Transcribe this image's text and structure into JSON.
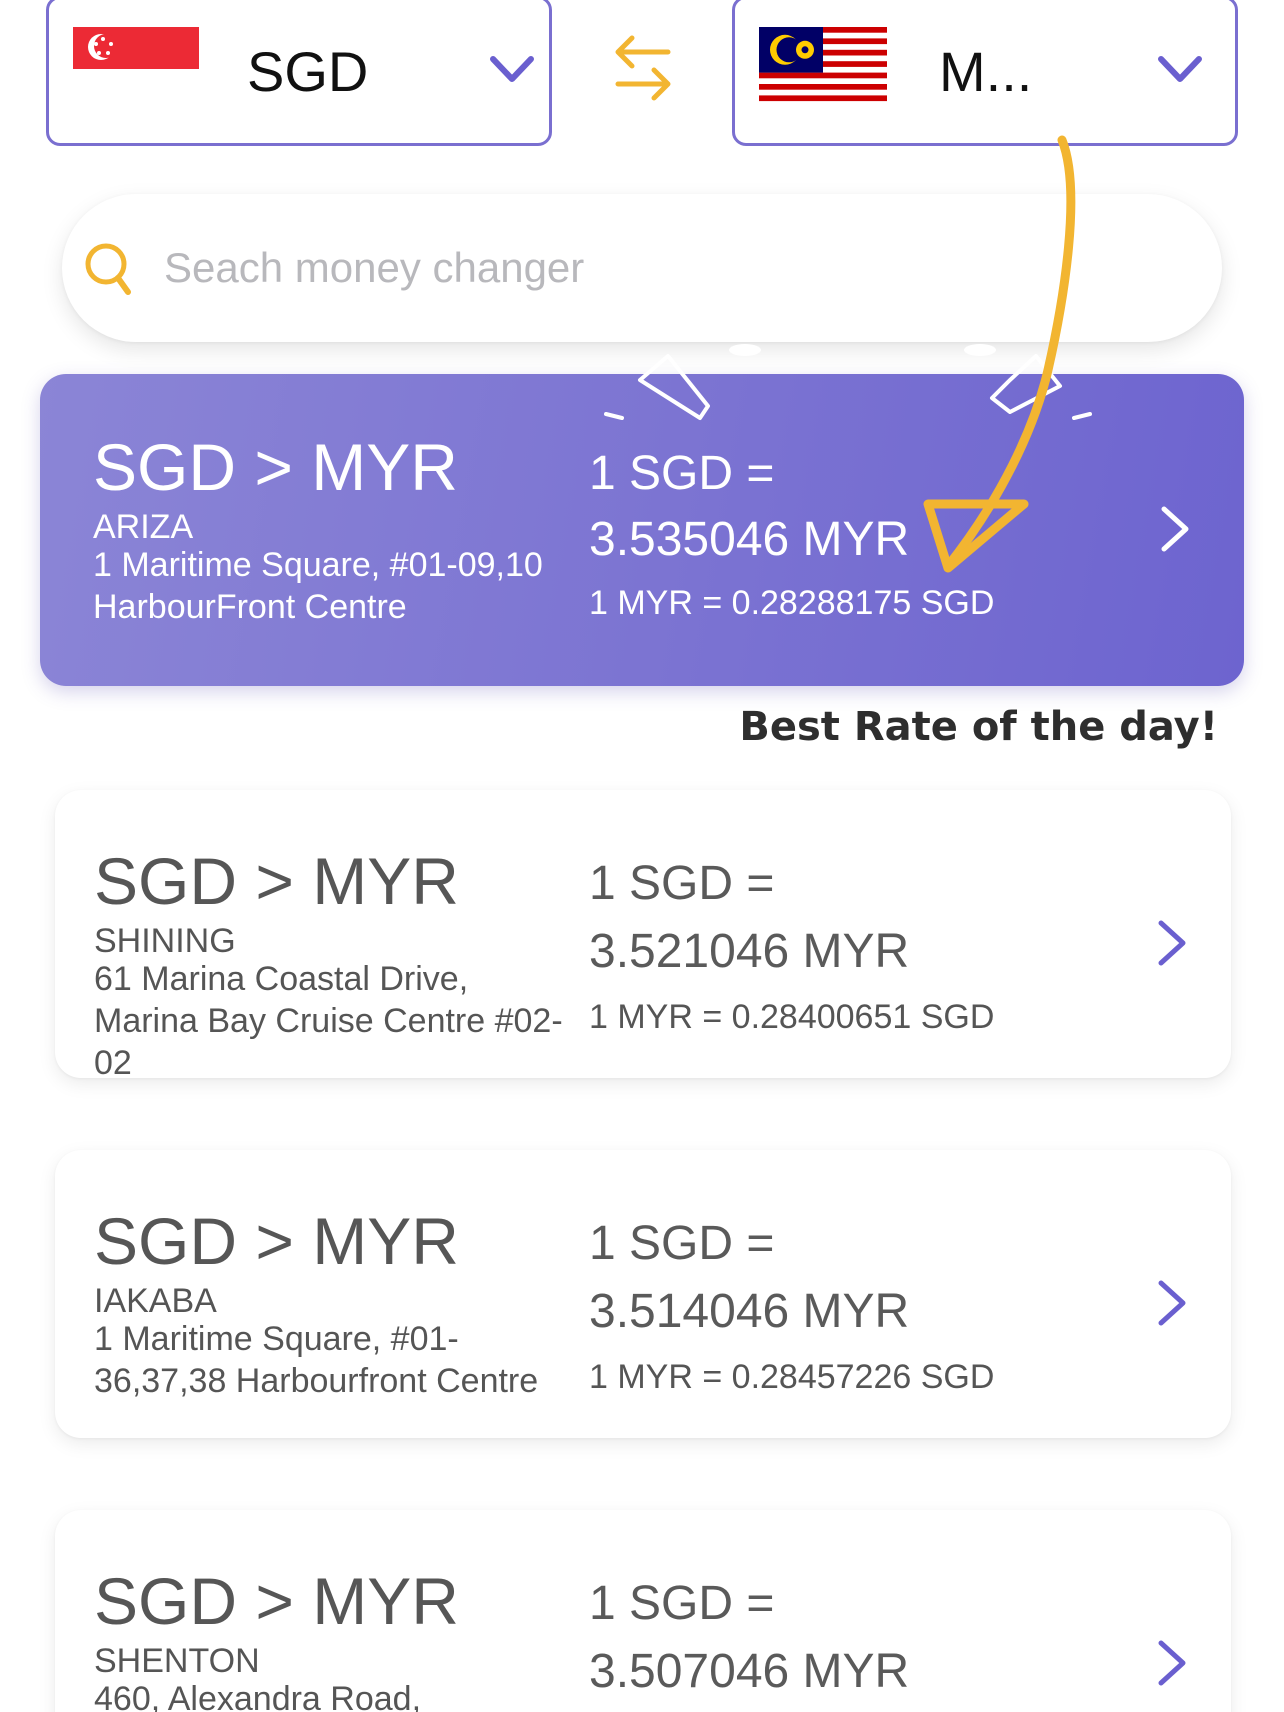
{
  "currency_from": {
    "code": "SGD",
    "flag": "singapore-flag"
  },
  "currency_to": {
    "code": "M...",
    "flag": "malaysia-flag"
  },
  "search": {
    "placeholder": "Seach money changer"
  },
  "colors": {
    "accent": "#7a6fd0",
    "highlight": "#f2b531",
    "best_card": "#7b73d2"
  },
  "best_label": "Best Rate of the day!",
  "offers": [
    {
      "pair": "SGD > MYR",
      "name": "ARIZA",
      "address": "1 Maritime Square, #01-09,10 HarbourFront Centre",
      "rate_line1": "1 SGD =",
      "rate_line2": "3.535046 MYR",
      "inverse": "1 MYR = 0.28288175 SGD"
    },
    {
      "pair": "SGD > MYR",
      "name": "SHINING",
      "address": "61 Marina Coastal Drive, Marina Bay Cruise Centre #02-02",
      "rate_line1": "1 SGD =",
      "rate_line2": "3.521046 MYR",
      "inverse": "1 MYR = 0.28400651 SGD"
    },
    {
      "pair": "SGD > MYR",
      "name": "IAKABA",
      "address": "1 Maritime Square, #01-36,37,38 Harbourfront Centre",
      "rate_line1": "1 SGD =",
      "rate_line2": "3.514046 MYR",
      "inverse": "1 MYR = 0.28457226 SGD"
    },
    {
      "pair": "SGD > MYR",
      "name": "SHENTON",
      "address": "460, Alexandra Road,",
      "rate_line1": "1 SGD =",
      "rate_line2": "3.507046 MYR",
      "inverse": ""
    }
  ]
}
